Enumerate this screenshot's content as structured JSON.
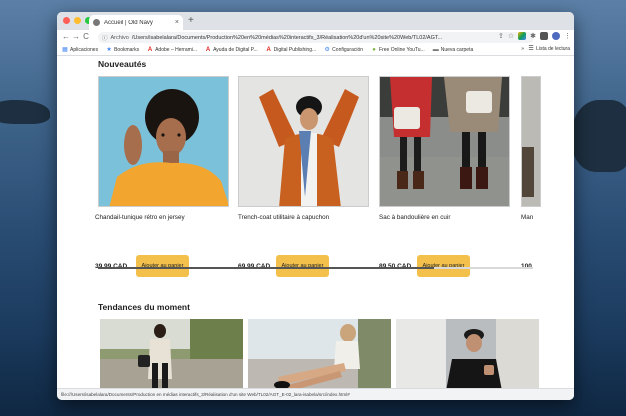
{
  "browser": {
    "tab_title": "Accueil | Old Navy",
    "tab_close": "×",
    "new_tab": "+",
    "nav": {
      "back": "←",
      "forward": "→",
      "reload": "C"
    },
    "address_label": "Archivo",
    "address": "/Users/isabelalara/Documents/Production%20en%20médias%20interactifs_3/Réalisation%20d'un%20site%20Web/TL02/AGT...",
    "bookmarks": [
      {
        "label": "Aplicaciones",
        "icon": "apps-grid-icon"
      },
      {
        "label": "Bookmarks",
        "icon": "star-icon"
      },
      {
        "label": "Adobe – Herrami...",
        "icon": "adobe-icon"
      },
      {
        "label": "Ayuda de Digital P...",
        "icon": "adobe-icon"
      },
      {
        "label": "Digital Publishing...",
        "icon": "adobe-icon"
      },
      {
        "label": "Configuración",
        "icon": "gear-icon"
      },
      {
        "label": "Free Online YouTu...",
        "icon": "youtube-icon"
      },
      {
        "label": "Nueva carpeta",
        "icon": "folder-icon"
      }
    ],
    "reading_list": "Lista de lectura",
    "status_url": "file:///Users/isabelalara/Documents/Production en médias interactifs_3/Réalisation d'un site Web/TL02/AGT_E-02_lara-isabela/src/index.html#"
  },
  "colors": {
    "button": "#f3c14b",
    "text": "#222222"
  },
  "page": {
    "new_section_title": "Nouveautés",
    "products": [
      {
        "name": "Chandail-tunique rétro en jersey",
        "price": "39,99 CAD",
        "button": "Ajouter au panier"
      },
      {
        "name": "Trench-coat utilitaire à capuchon",
        "price": "69,99 CAD",
        "button": "Ajouter au panier"
      },
      {
        "name": "Sac à bandoulière en cuir",
        "price": "89,50 CAD",
        "button": "Ajouter au panier"
      },
      {
        "name": "Man",
        "price": "100"
      }
    ],
    "trends_title": "Tendances du moment"
  }
}
